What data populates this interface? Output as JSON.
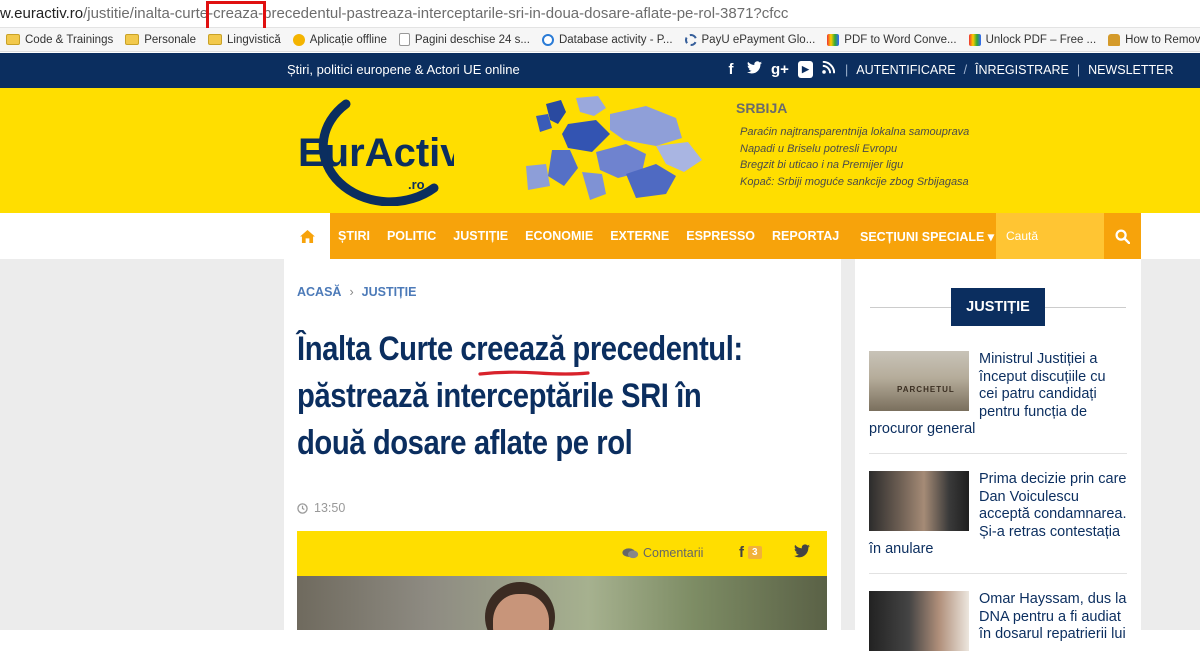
{
  "browser": {
    "url_domain": "w.euractiv.ro",
    "url_path": "/justitie/inalta-curte-creaza-precedentul-pastreaza-interceptarile-sri-in-doua-dosare-aflate-pe-rol-3871?cfcc",
    "bookmarks": [
      {
        "label": "Code & Trainings",
        "icon": "folder-icon"
      },
      {
        "label": "Personale",
        "icon": "folder-icon"
      },
      {
        "label": "Lingvistică",
        "icon": "folder-icon"
      },
      {
        "label": "Aplicație offline",
        "icon": "globe-icon"
      },
      {
        "label": "Pagini deschise 24 s...",
        "icon": "document-icon"
      },
      {
        "label": "Database activity - P...",
        "icon": "ring-icon"
      },
      {
        "label": "PayU ePayment Glo...",
        "icon": "payu-icon"
      },
      {
        "label": "PDF to Word Conve...",
        "icon": "colorful-icon"
      },
      {
        "label": "Unlock PDF – Free ...",
        "icon": "colorful-icon"
      },
      {
        "label": "How to Remove PD...",
        "icon": "hat-icon"
      }
    ]
  },
  "topbar": {
    "tagline": "Știri, politici europene & Actori UE online",
    "social": {
      "facebook": "f",
      "twitter": "t",
      "gplus": "g+",
      "youtube": "▶",
      "rss": "rss"
    },
    "links": [
      "AUTENTIFICARE",
      "ÎNREGISTRARE",
      "NEWSLETTER"
    ]
  },
  "header": {
    "logo_text": "EurActiv",
    "logo_suffix": ".ro",
    "region_title": "SRBIJA",
    "region_news": [
      "Paraćin najtransparentnija lokalna samouprava",
      "Napadi u Briselu potresli Evropu",
      "Bregzit bi uticao i na Premijer ligu",
      "Kopač: Srbiji moguće sankcije zbog Srbijagasa"
    ]
  },
  "nav": {
    "items": [
      "ȘTIRI",
      "POLITIC",
      "JUSTIȚIE",
      "ECONOMIE",
      "EXTERNE",
      "ESPRESSO",
      "REPORTAJ"
    ],
    "special": "SECȚIUNI SPECIALE ▾",
    "search_placeholder": "Caută"
  },
  "article": {
    "breadcrumb": [
      "ACASĂ",
      "JUSTIȚIE"
    ],
    "title_lines": [
      [
        "Înalta Curte ",
        "creează",
        " precedentul:"
      ],
      "păstrează interceptările SRI în",
      "două dosare aflate pe rol"
    ],
    "time": "13:50",
    "comments_label": "Comentarii",
    "facebook_count": "3"
  },
  "sidebar": {
    "section_label": "JUSTIȚIE",
    "items": [
      {
        "title": "Ministrul Justiției a început discuțiile cu cei patru candidați pentru funcția de procuror general",
        "thumb_text": "PARCHETUL"
      },
      {
        "title": "Prima decizie prin care Dan Voiculescu acceptă condamnarea. Și-a retras contestația în anulare",
        "thumb_text": ""
      },
      {
        "title": "Omar Hayssam, dus la DNA pentru a fi audiat în dosarul repatrierii lui",
        "thumb_text": ""
      }
    ]
  }
}
